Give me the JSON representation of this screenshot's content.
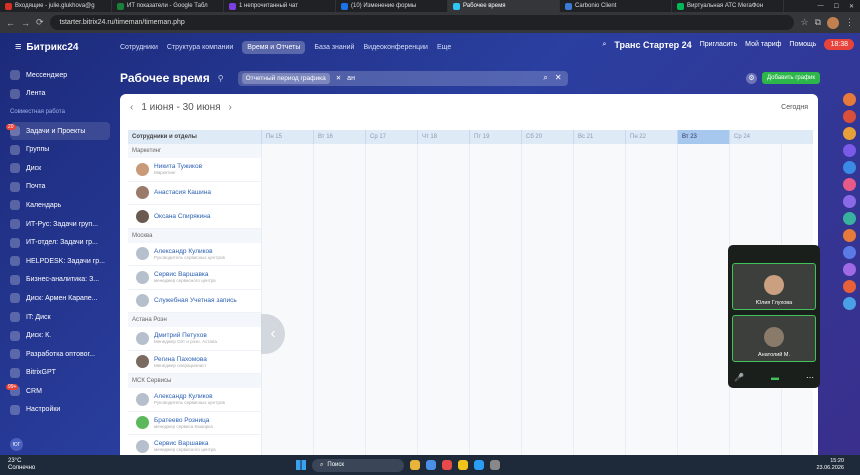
{
  "browser": {
    "tabs": [
      {
        "title": "Входящие - julie.glukhova@g",
        "color": "#d93025"
      },
      {
        "title": "ИТ показатели - Google Табл",
        "color": "#188038"
      },
      {
        "title": "1 непрочитанный чат",
        "color": "#7b3fe4"
      },
      {
        "title": "(10) Изменение формы",
        "color": "#1a73e8"
      },
      {
        "title": "Рабочее время",
        "color": "#2fc6f6"
      },
      {
        "title": "Carbonio Client",
        "color": "#3a7bd5"
      },
      {
        "title": "Виртуальная АТС МегаФон",
        "color": "#00b956"
      }
    ],
    "url": "tstarter.bitrix24.ru/timeman/timeman.php"
  },
  "sidebar": {
    "logo": "Битрикс24",
    "items": [
      {
        "label": "Мессенджер",
        "icon": "chat-icon",
        "badge": ""
      },
      {
        "label": "Лента",
        "icon": "feed-icon",
        "badge": ""
      },
      {
        "label": "Совместная работа",
        "icon": "",
        "badge": "",
        "section": true
      },
      {
        "label": "Задачи и Проекты",
        "icon": "tasks-icon",
        "badge": "20"
      },
      {
        "label": "Группы",
        "icon": "groups-icon",
        "badge": ""
      },
      {
        "label": "Диск",
        "icon": "disk-icon",
        "badge": ""
      },
      {
        "label": "Почта",
        "icon": "mail-icon",
        "badge": ""
      },
      {
        "label": "Календарь",
        "icon": "calendar-icon",
        "badge": ""
      },
      {
        "label": "ИТ-Рус: Задачи груп...",
        "icon": "group-icon",
        "badge": ""
      },
      {
        "label": "ИТ-отдел: Задачи гр...",
        "icon": "group-icon",
        "badge": ""
      },
      {
        "label": "HELPDESK: Задачи гр...",
        "icon": "group-icon",
        "badge": ""
      },
      {
        "label": "Бизнес-аналитика: З...",
        "icon": "group-icon",
        "badge": ""
      },
      {
        "label": "Диск: Армен Карапе...",
        "icon": "disk-icon",
        "badge": ""
      },
      {
        "label": "IT: Диск",
        "icon": "disk-icon",
        "badge": ""
      },
      {
        "label": "Диск: К.",
        "icon": "disk-icon",
        "badge": ""
      },
      {
        "label": "Разработка оптовог...",
        "icon": "group-icon",
        "badge": ""
      },
      {
        "label": "BitrixGPT",
        "icon": "ai-icon",
        "badge": ""
      },
      {
        "label": "CRM",
        "icon": "crm-icon",
        "badge": "99+"
      },
      {
        "label": "Настройки",
        "icon": "gear-icon",
        "badge": ""
      }
    ]
  },
  "topnav": {
    "items": [
      "Сотрудники",
      "Структура компании",
      "Время и Отчеты",
      "База знаний",
      "Видеоконференции",
      "Еще"
    ],
    "current": 2
  },
  "topright": {
    "company": "Транс Стартер 24",
    "invite": "Пригласить",
    "tariff": "Мой тариф",
    "help": "Помощь",
    "time": "18:38"
  },
  "page": {
    "title": "Рабочее время",
    "filter_chip": "Отчетный период графика",
    "search_value": "ан",
    "add_button": "Добавить график",
    "date_range": "1 июня - 30 июня",
    "today": "Сегодня"
  },
  "grid": {
    "header_label": "Сотрудники и отделы",
    "days": [
      "Пн 15",
      "Вт 16",
      "Ср 17",
      "Чт 18",
      "Пт 19",
      "Сб 20",
      "Вс 21",
      "Пн 22",
      "Вт 23",
      "Ср 24"
    ],
    "highlight_index": 8,
    "groups": [
      {
        "name": "Маркетинг",
        "people": [
          {
            "name": "Никита Тужиков",
            "role": "Маркетинг"
          },
          {
            "name": "Анастасия Кашина",
            "role": ""
          },
          {
            "name": "Оксана Спирякина",
            "role": ""
          }
        ]
      },
      {
        "name": "Москва",
        "people": [
          {
            "name": "Александр Куликов",
            "role": "Руководитель сервисных центров"
          },
          {
            "name": "Сервис Варшавка",
            "role": "менеджер сервисного центра"
          },
          {
            "name": "Служебная Учетная запись",
            "role": ""
          }
        ]
      },
      {
        "name": "Астана Роэн",
        "people": [
          {
            "name": "Дмитрий Петухов",
            "role": "Менеджер Опт и розн. Астана"
          },
          {
            "name": "Регина Пахомова",
            "role": "Менеджер операционист"
          }
        ]
      },
      {
        "name": "МСК Сервисы",
        "people": [
          {
            "name": "Александр Куликов",
            "role": "Руководитель сервисных центров"
          },
          {
            "name": "Братеево Розница",
            "role": "менеджер сервиса Каширка"
          },
          {
            "name": "Сервис Варшавка",
            "role": "менеджер сервисного центра"
          }
        ]
      }
    ]
  },
  "video": {
    "participants": [
      "Юлия Глухова",
      "Анатолий М."
    ]
  },
  "taskbar": {
    "weather_temp": "23°C",
    "weather_text": "Солнечно",
    "search": "Поиск",
    "time": "15:20",
    "date": "23.06.2026"
  }
}
